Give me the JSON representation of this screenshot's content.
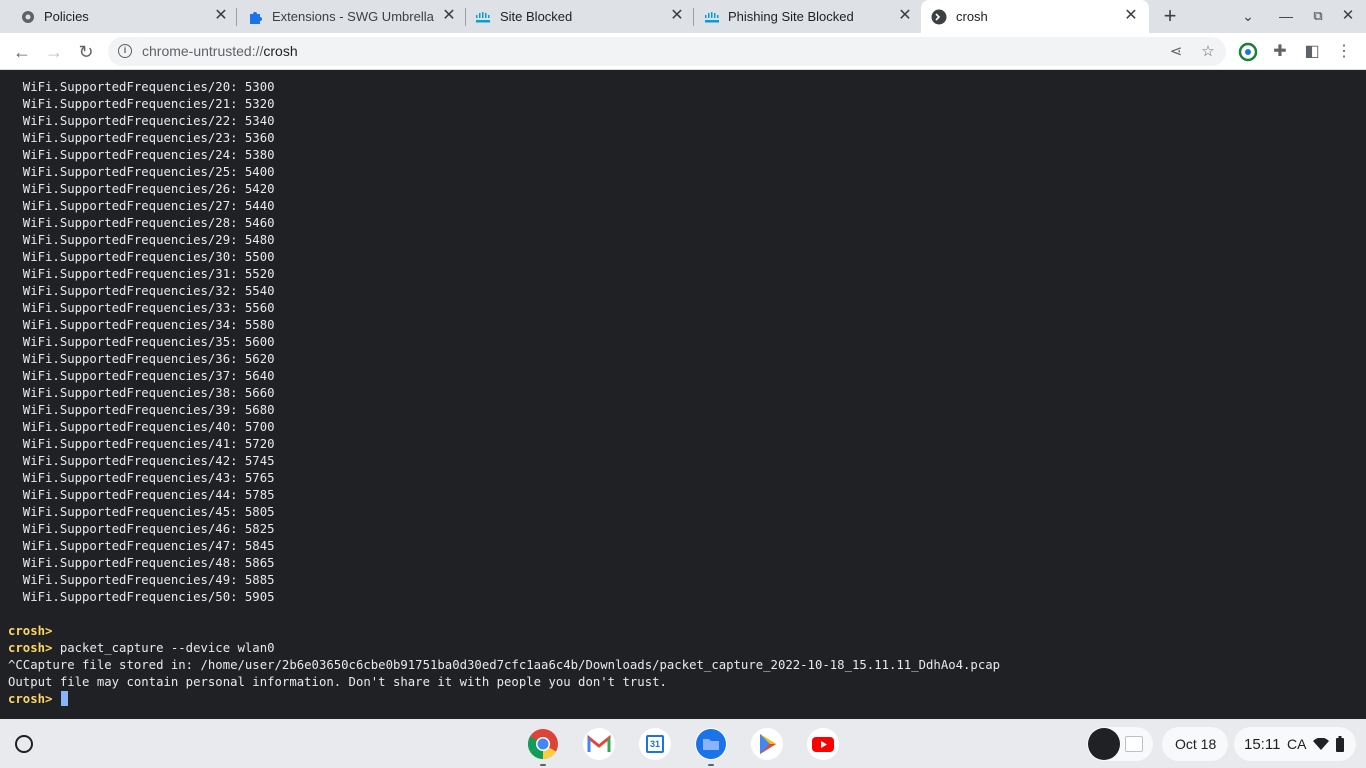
{
  "tabs": [
    {
      "title": "Policies",
      "icon": "gear-icon",
      "active": false
    },
    {
      "title": "Extensions - SWG Umbrella Ch",
      "icon": "puzzle-icon",
      "active": false
    },
    {
      "title": "Site Blocked",
      "icon": "cisco-logo-icon",
      "active": false
    },
    {
      "title": "Phishing Site Blocked",
      "icon": "cisco-logo-icon",
      "active": false
    },
    {
      "title": "crosh",
      "icon": "terminal-icon",
      "active": true
    }
  ],
  "omnibox": {
    "scheme": "chrome-untrusted://",
    "host": "crosh"
  },
  "terminal": {
    "freq_prefix": "  WiFi.SupportedFrequencies/",
    "frequencies": [
      {
        "index": "20",
        "value": "5300"
      },
      {
        "index": "21",
        "value": "5320"
      },
      {
        "index": "22",
        "value": "5340"
      },
      {
        "index": "23",
        "value": "5360"
      },
      {
        "index": "24",
        "value": "5380"
      },
      {
        "index": "25",
        "value": "5400"
      },
      {
        "index": "26",
        "value": "5420"
      },
      {
        "index": "27",
        "value": "5440"
      },
      {
        "index": "28",
        "value": "5460"
      },
      {
        "index": "29",
        "value": "5480"
      },
      {
        "index": "30",
        "value": "5500"
      },
      {
        "index": "31",
        "value": "5520"
      },
      {
        "index": "32",
        "value": "5540"
      },
      {
        "index": "33",
        "value": "5560"
      },
      {
        "index": "34",
        "value": "5580"
      },
      {
        "index": "35",
        "value": "5600"
      },
      {
        "index": "36",
        "value": "5620"
      },
      {
        "index": "37",
        "value": "5640"
      },
      {
        "index": "38",
        "value": "5660"
      },
      {
        "index": "39",
        "value": "5680"
      },
      {
        "index": "40",
        "value": "5700"
      },
      {
        "index": "41",
        "value": "5720"
      },
      {
        "index": "42",
        "value": "5745"
      },
      {
        "index": "43",
        "value": "5765"
      },
      {
        "index": "44",
        "value": "5785"
      },
      {
        "index": "45",
        "value": "5805"
      },
      {
        "index": "46",
        "value": "5825"
      },
      {
        "index": "47",
        "value": "5845"
      },
      {
        "index": "48",
        "value": "5865"
      },
      {
        "index": "49",
        "value": "5885"
      },
      {
        "index": "50",
        "value": "5905"
      }
    ],
    "prompt": "crosh>",
    "command": " packet_capture --device wlan0",
    "capture_line": "^CCapture file stored in: /home/user/2b6e03650c6cbe0b91751ba0d30ed7cfc1aa6c4b/Downloads/packet_capture_2022-10-18_15.11.11_DdhAo4.pcap",
    "warning_line": "Output file may contain personal information. Don't share it with people you don't trust."
  },
  "shelf": {
    "apps": [
      "chrome-icon",
      "gmail-icon",
      "calendar-icon",
      "files-icon",
      "play-store-icon",
      "youtube-icon"
    ],
    "calendar_day": "31",
    "date": "Oct 18",
    "time": "15:11",
    "region": "CA"
  }
}
